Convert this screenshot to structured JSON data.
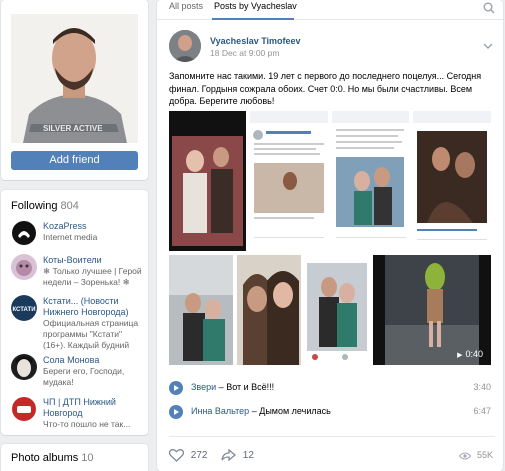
{
  "profile": {
    "add_friend_label": "Add friend"
  },
  "following": {
    "title": "Following",
    "count": "804",
    "items": [
      {
        "name": "KozaPress",
        "desc": "Internet media"
      },
      {
        "name": "Коты-Воители",
        "desc": "❄ Только лучшее | Герой недели – Зоренька! ❄"
      },
      {
        "name": "Кстати... (Новости Нижнего Новгорода)",
        "desc": "Официальная страница программы \"Кстати\" (16+). Каждый будний"
      },
      {
        "name": "Сола Монова",
        "desc": "Береги его, Господи, мудака!"
      },
      {
        "name": "ЧП | ДТП Нижний Новгород",
        "desc": "Что-то пошло не так..."
      }
    ],
    "kstati_logo_text": "КСТАТИ"
  },
  "albums": {
    "title": "Photo albums",
    "count": "10"
  },
  "tabs": [
    {
      "label": "All posts"
    },
    {
      "label": "Posts by Vyacheslav"
    }
  ],
  "post": {
    "author": "Vyacheslav Timofeev",
    "date": "18 Dec at 9:00 pm",
    "text": "Запомните нас такими. 19 лет с первого до последнего поцелуя... Сегодня финал. Гордыня сожрала обоих. Счет 0:0. Но мы были счастливы. Всем добра. Берегите любовь!",
    "video_duration": "0:40",
    "tracks": [
      {
        "artist": "Звери",
        "title": "Вот и Всё!!!",
        "duration": "3:40"
      },
      {
        "artist": "Инна Вальтер",
        "title": "Дымом лечилась",
        "duration": "6:47"
      }
    ],
    "likes": "272",
    "shares": "12",
    "views": "55K"
  },
  "colors": {
    "accent": "#5181b8",
    "link": "#2a5885",
    "background": "#edeef0"
  }
}
